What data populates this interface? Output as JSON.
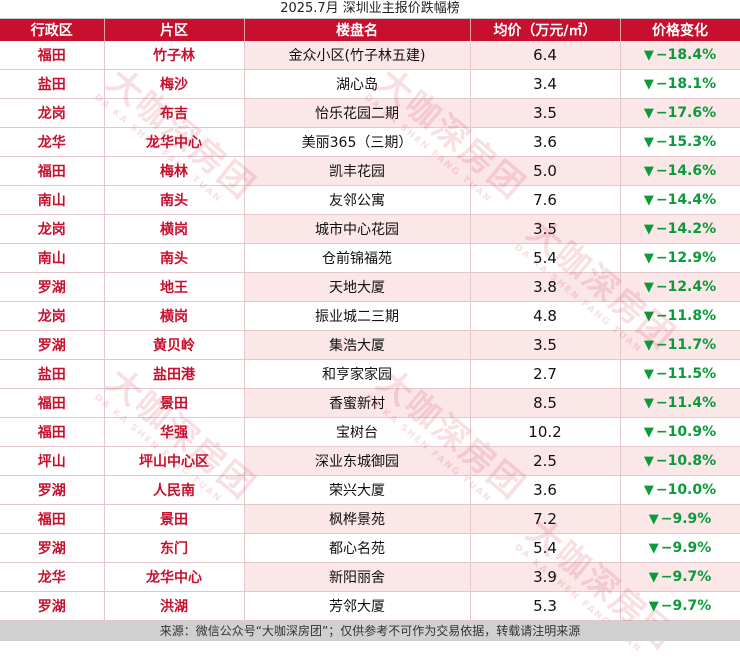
{
  "title": "2025.7月 深圳业主报价跌幅榜",
  "columns": [
    "行政区",
    "片区",
    "楼盘名",
    "均价（万元/㎡）",
    "价格变化"
  ],
  "rows": [
    {
      "district": "福田",
      "area": "竹子林",
      "name": "金众小区(竹子林五建)",
      "price": "6.4",
      "change": "−18.4%"
    },
    {
      "district": "盐田",
      "area": "梅沙",
      "name": "湖心岛",
      "price": "3.4",
      "change": "−18.1%"
    },
    {
      "district": "龙岗",
      "area": "布吉",
      "name": "怡乐花园二期",
      "price": "3.5",
      "change": "−17.6%"
    },
    {
      "district": "龙华",
      "area": "龙华中心",
      "name": "美丽365（三期）",
      "price": "3.6",
      "change": "−15.3%"
    },
    {
      "district": "福田",
      "area": "梅林",
      "name": "凯丰花园",
      "price": "5.0",
      "change": "−14.6%"
    },
    {
      "district": "南山",
      "area": "南头",
      "name": "友邻公寓",
      "price": "7.6",
      "change": "−14.4%"
    },
    {
      "district": "龙岗",
      "area": "横岗",
      "name": "城市中心花园",
      "price": "3.5",
      "change": "−14.2%"
    },
    {
      "district": "南山",
      "area": "南头",
      "name": "仓前锦福苑",
      "price": "5.4",
      "change": "−12.9%"
    },
    {
      "district": "罗湖",
      "area": "地王",
      "name": "天地大厦",
      "price": "3.8",
      "change": "−12.4%"
    },
    {
      "district": "龙岗",
      "area": "横岗",
      "name": "振业城二三期",
      "price": "4.8",
      "change": "−11.8%"
    },
    {
      "district": "罗湖",
      "area": "黄贝岭",
      "name": "集浩大厦",
      "price": "3.5",
      "change": "−11.7%"
    },
    {
      "district": "盐田",
      "area": "盐田港",
      "name": "和亨家家园",
      "price": "2.7",
      "change": "−11.5%"
    },
    {
      "district": "福田",
      "area": "景田",
      "name": "香蜜新村",
      "price": "8.5",
      "change": "−11.4%"
    },
    {
      "district": "福田",
      "area": "华强",
      "name": "宝树台",
      "price": "10.2",
      "change": "−10.9%"
    },
    {
      "district": "坪山",
      "area": "坪山中心区",
      "name": "深业东城御园",
      "price": "2.5",
      "change": "−10.8%"
    },
    {
      "district": "罗湖",
      "area": "人民南",
      "name": "荣兴大厦",
      "price": "3.6",
      "change": "−10.0%"
    },
    {
      "district": "福田",
      "area": "景田",
      "name": "枫桦景苑",
      "price": "7.2",
      "change": "−9.9%"
    },
    {
      "district": "罗湖",
      "area": "东门",
      "name": "都心名苑",
      "price": "5.4",
      "change": "−9.9%"
    },
    {
      "district": "龙华",
      "area": "龙华中心",
      "name": "新阳丽舍",
      "price": "3.9",
      "change": "−9.7%"
    },
    {
      "district": "罗湖",
      "area": "洪湖",
      "name": "芳邻大厦",
      "price": "5.3",
      "change": "−9.7%"
    }
  ],
  "arrow_icon": "down-triangle-icon",
  "watermark": {
    "big": "大咖深房团",
    "small": "DA KA SHEN FANG TUAN"
  },
  "footer": "来源：微信公众号“大咖深房团”；仅供参考不可作为交易依据，转载请注明来源",
  "colors": {
    "header_bg": "#c8102e",
    "accent_red": "#c8102e",
    "down_green": "#0a9b3a",
    "stripe": "#fbe6e8"
  }
}
